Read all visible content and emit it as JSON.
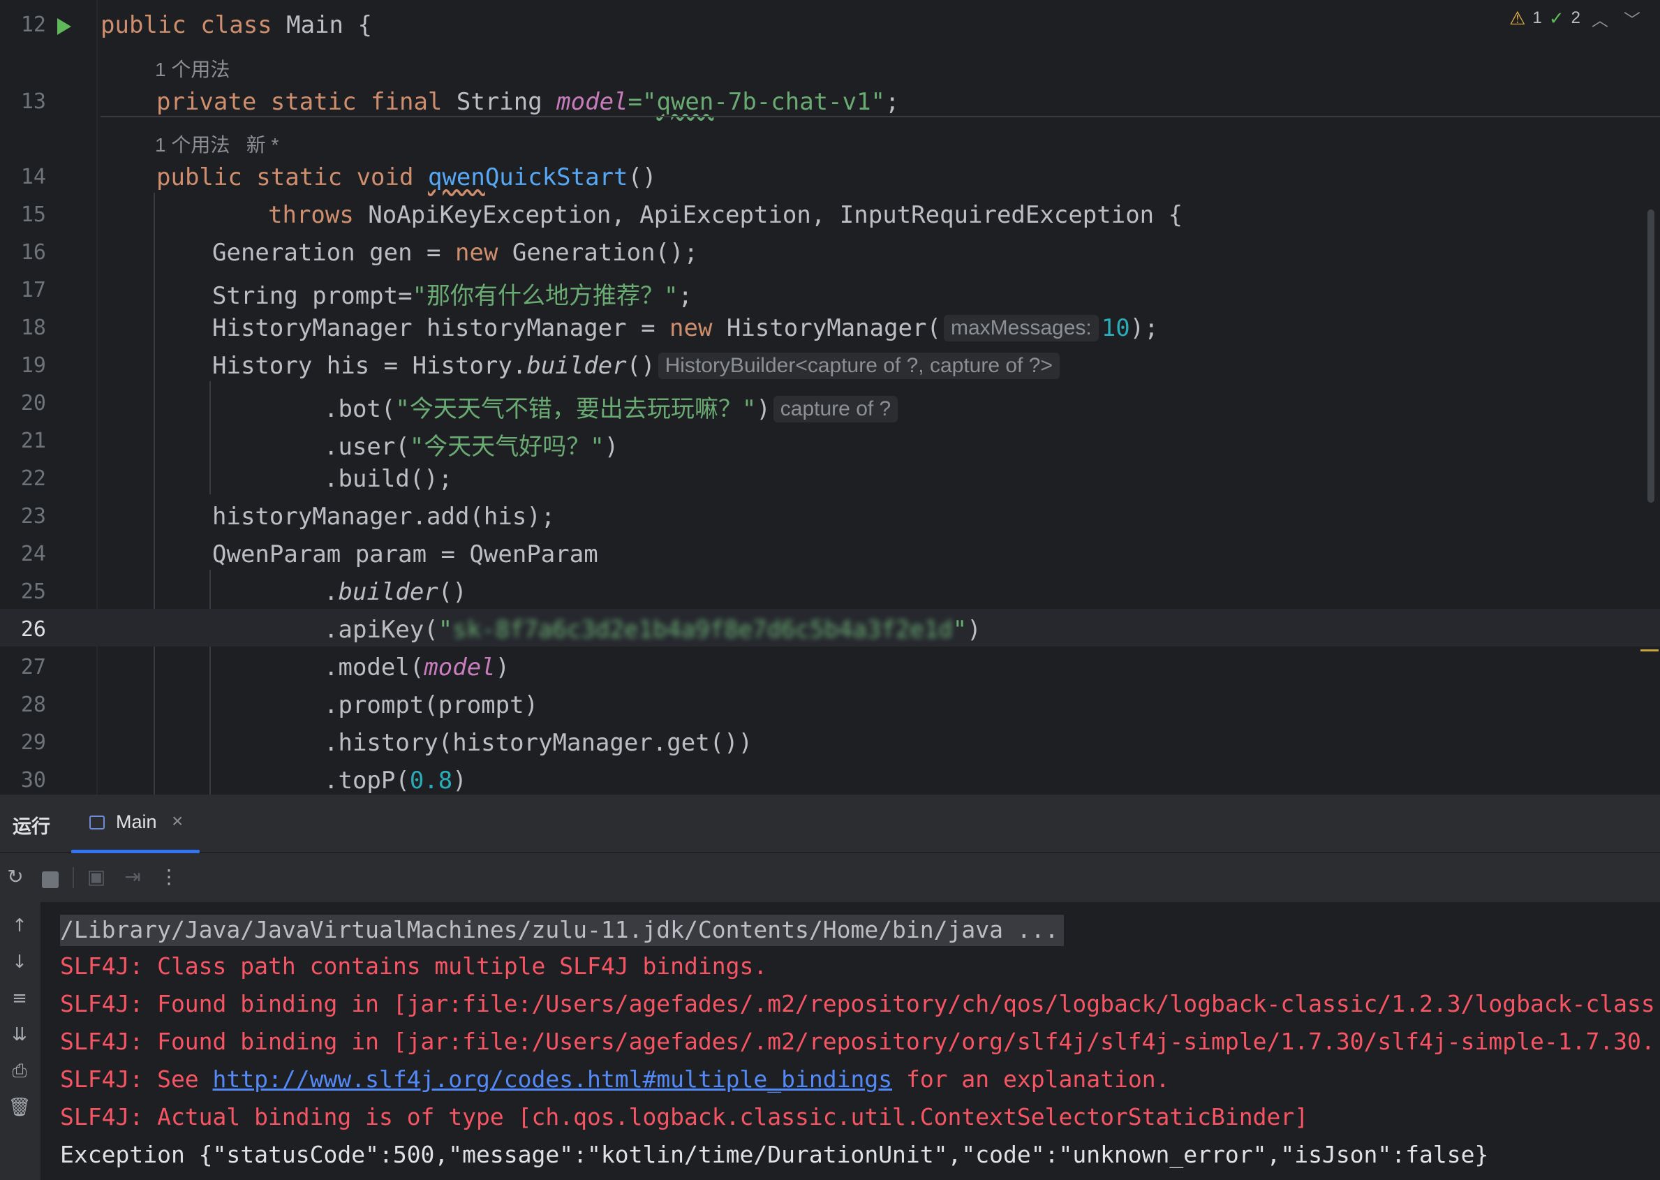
{
  "editor": {
    "inspections": {
      "warnings": "1",
      "weak_warnings": "2"
    },
    "usage_hints": [
      "1 个用法",
      "1 个用法   新 *"
    ],
    "lines": {
      "l12": {
        "num": "12",
        "t1": "public class ",
        "t2": "Main {"
      },
      "l13": {
        "num": "13",
        "t1": "private static final ",
        "t2": "String ",
        "t3": "model",
        "t4": "=\"",
        "t5": "qwen",
        "t6": "-7b-chat-v1\"",
        "t7": ";"
      },
      "l14": {
        "num": "14",
        "t1": "public static void ",
        "t2": "qwen",
        "t3": "QuickStart",
        "t4": "()"
      },
      "l15": {
        "num": "15",
        "t1": "throws ",
        "t2": "NoApiKeyException, ApiException, InputRequiredException {"
      },
      "l16": {
        "num": "16",
        "t1": "Generation gen = ",
        "t2": "new ",
        "t3": "Generation();"
      },
      "l17": {
        "num": "17",
        "t1": "String prompt=",
        "t2": "\"那你有什么地方推荐？\"",
        "t3": ";"
      },
      "l18": {
        "num": "18",
        "t1": "HistoryManager historyManager = ",
        "t2": "new ",
        "t3": "HistoryManager(",
        "hint": "maxMessages:",
        "t4": "10",
        "t5": ");"
      },
      "l19": {
        "num": "19",
        "t1": "History his = History.",
        "t2": "builder",
        "t3": "()",
        "hint": "HistoryBuilder<capture of ?, capture of ?>"
      },
      "l20": {
        "num": "20",
        "t1": ".bot(",
        "t2": "\"今天天气不错，要出去玩玩嘛？\"",
        "t3": ")",
        "hint": "capture of ?"
      },
      "l21": {
        "num": "21",
        "t1": ".user(",
        "t2": "\"今天天气好吗？\"",
        "t3": ")"
      },
      "l22": {
        "num": "22",
        "t1": ".build();"
      },
      "l23": {
        "num": "23",
        "t1": "historyManager.add(his);"
      },
      "l24": {
        "num": "24",
        "t1": "QwenParam param = QwenParam"
      },
      "l25": {
        "num": "25",
        "t1": ".",
        "t2": "builder",
        "t3": "()"
      },
      "l26": {
        "num": "26",
        "t1": ".apiKey(",
        "t2": "\"",
        "t3": "sk-8f7a6c3d2e1b4a9f8e7d6c5b4a3f2e1d",
        "t4": "\"",
        "t5": ")"
      },
      "l27": {
        "num": "27",
        "t1": ".model(",
        "t2": "model",
        "t3": ")"
      },
      "l28": {
        "num": "28",
        "t1": ".prompt(prompt)"
      },
      "l29": {
        "num": "29",
        "t1": ".history(historyManager.get())"
      },
      "l30": {
        "num": "30",
        "t1": ".topP(",
        "t2": "0.8",
        "t3": ")"
      }
    }
  },
  "run_panel": {
    "title": "运行",
    "tab_label": "Main",
    "tab_close": "×",
    "toolbar_icons": [
      "rerun-icon",
      "stop-icon",
      "screenshot-icon",
      "export-icon",
      "more-icon"
    ],
    "side_icons": [
      "arrow-up-icon",
      "arrow-down-icon",
      "soft-wrap-icon",
      "scroll-to-end-icon",
      "print-icon",
      "clear-icon"
    ],
    "console": {
      "c1": "/Library/Java/JavaVirtualMachines/zulu-11.jdk/Contents/Home/bin/java ...",
      "c2": "SLF4J: Class path contains multiple SLF4J bindings.",
      "c3": "SLF4J: Found binding in [jar:file:/Users/agefades/.m2/repository/ch/qos/logback/logback-classic/1.2.3/logback-class",
      "c4": "SLF4J: Found binding in [jar:file:/Users/agefades/.m2/repository/org/slf4j/slf4j-simple/1.7.30/slf4j-simple-1.7.30.",
      "c5a": "SLF4J: See ",
      "c5b": "http://www.slf4j.org/codes.html#multiple_bindings",
      "c5c": " for an explanation.",
      "c6": "SLF4J: Actual binding is of type [ch.qos.logback.classic.util.ContextSelectorStaticBinder]",
      "c7": "Exception {\"statusCode\":500,\"message\":\"kotlin/time/DurationUnit\",\"code\":\"unknown_error\",\"isJson\":false}"
    }
  }
}
